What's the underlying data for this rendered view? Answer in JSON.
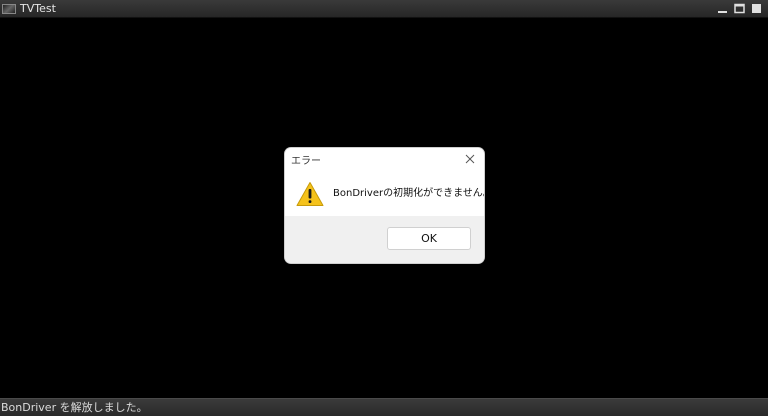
{
  "window": {
    "title": "TVTest",
    "icons": {
      "app": "tvtest-app-icon",
      "minimize": "minimize-icon",
      "restore": "restore-icon",
      "maximize": "maximize-icon"
    }
  },
  "dialog": {
    "title": "エラー",
    "message": "BonDriverの初期化ができません。",
    "ok_label": "OK",
    "icons": {
      "warning": "warning-icon",
      "close": "close-icon"
    },
    "colors": {
      "warning_fill": "#f5c21b",
      "footer_bg": "#f0f0f0"
    }
  },
  "statusbar": {
    "text": "BonDriver を解放しました。"
  }
}
